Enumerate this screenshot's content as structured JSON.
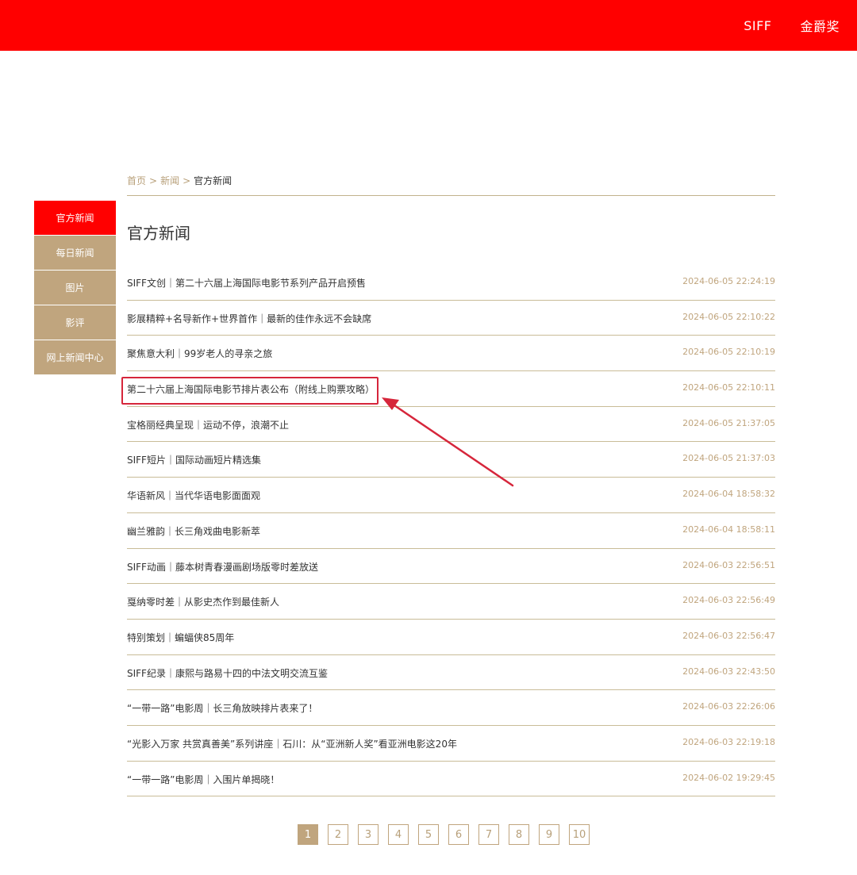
{
  "header": {
    "nav": [
      "SIFF",
      "金爵奖"
    ],
    "colors": {
      "bar": "#ff0000",
      "accent": "#c0a57e"
    }
  },
  "breadcrumb": {
    "items": [
      "首页",
      "新闻"
    ],
    "current": "官方新闻",
    "separator": ">"
  },
  "sidebar": {
    "items": [
      {
        "label": "官方新闻",
        "active": true
      },
      {
        "label": "每日新闻"
      },
      {
        "label": "图片"
      },
      {
        "label": "影评"
      },
      {
        "label": "网上新闻中心"
      }
    ]
  },
  "page_title": "官方新闻",
  "news": [
    {
      "title": "SIFF文创｜第二十六届上海国际电影节系列产品开启预售",
      "date": "2024-06-05 22:24:19"
    },
    {
      "title": "影展精粹+名导新作+世界首作｜最新的佳作永远不会缺席",
      "date": "2024-06-05 22:10:22"
    },
    {
      "title": "聚焦意大利｜99岁老人的寻亲之旅",
      "date": "2024-06-05 22:10:19"
    },
    {
      "title": "第二十六届上海国际电影节排片表公布（附线上购票攻略）",
      "date": "2024-06-05 22:10:11",
      "highlighted": true
    },
    {
      "title": "宝格丽经典呈现｜运动不停，浪潮不止",
      "date": "2024-06-05 21:37:05"
    },
    {
      "title": "SIFF短片｜国际动画短片精选集",
      "date": "2024-06-05 21:37:03"
    },
    {
      "title": "华语新风｜当代华语电影面面观",
      "date": "2024-06-04 18:58:32"
    },
    {
      "title": "幽兰雅韵｜长三角戏曲电影新萃",
      "date": "2024-06-04 18:58:11"
    },
    {
      "title": "SIFF动画｜藤本树青春漫画剧场版零时差放送",
      "date": "2024-06-03 22:56:51"
    },
    {
      "title": "戛纳零时差｜从影史杰作到最佳新人",
      "date": "2024-06-03 22:56:49"
    },
    {
      "title": "特别策划｜蝙蝠侠85周年",
      "date": "2024-06-03 22:56:47"
    },
    {
      "title": "SIFF纪录｜康熙与路易十四的中法文明交流互鉴",
      "date": "2024-06-03 22:43:50"
    },
    {
      "title": "“一带一路”电影周｜长三角放映排片表来了！",
      "date": "2024-06-03 22:26:06"
    },
    {
      "title": "“光影入万家 共赏真善美”系列讲座｜石川：从“亚洲新人奖”看亚洲电影这20年",
      "date": "2024-06-03 22:19:18"
    },
    {
      "title": "“一带一路”电影周｜入围片单揭晓！",
      "date": "2024-06-02 19:29:45"
    }
  ],
  "pagination": {
    "pages": [
      "1",
      "2",
      "3",
      "4",
      "5",
      "6",
      "7",
      "8",
      "9",
      "10"
    ],
    "current": "1"
  },
  "annotation": {
    "color": "#d6263b"
  }
}
